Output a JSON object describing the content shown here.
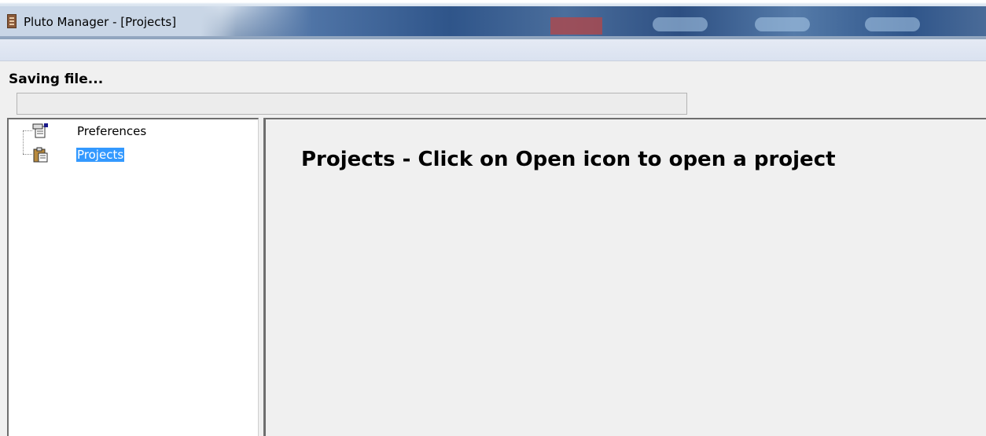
{
  "window": {
    "title": "Pluto Manager - [Projects]",
    "icon": "app-icon"
  },
  "status": {
    "label": "Saving file...",
    "progress": 0
  },
  "tree": {
    "items": [
      {
        "label": "Preferences",
        "icon": "preferences-icon",
        "selected": false
      },
      {
        "label": "Projects",
        "icon": "projects-icon",
        "selected": true
      }
    ]
  },
  "content": {
    "heading": "Projects - Click on Open icon to open a project"
  },
  "colors": {
    "selection": "#3399ff",
    "background": "#f0f0f0"
  }
}
